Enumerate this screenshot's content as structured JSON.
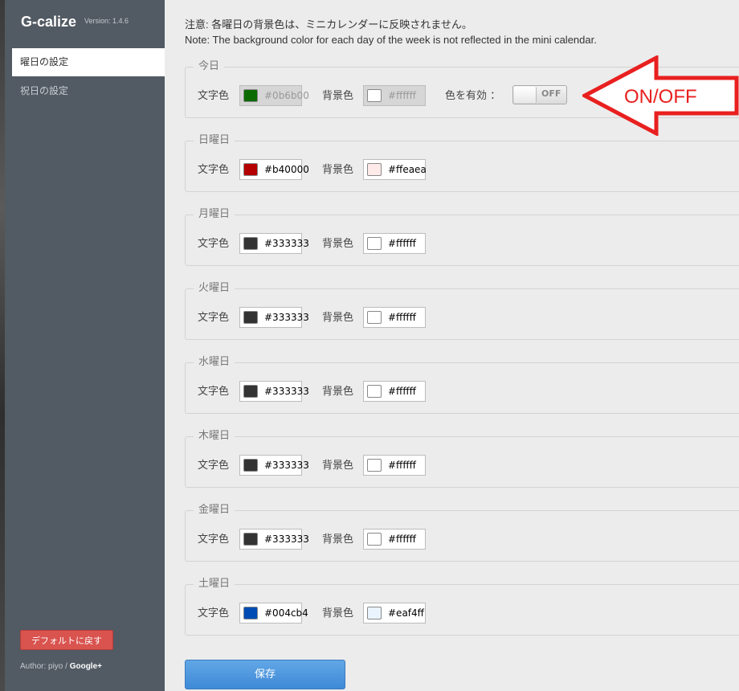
{
  "sidebar": {
    "title": "G-calize",
    "version": "Version: 1.4.6",
    "items": [
      {
        "label": "曜日の設定"
      },
      {
        "label": "祝日の設定"
      }
    ],
    "default_button": "デフォルトに戻す",
    "author_prefix": "Author: piyo / ",
    "author_link": "Google+"
  },
  "notice": {
    "jp": "注意: 各曜日の背景色は、ミニカレンダーに反映されません。",
    "en": "Note: The background color for each day of the week is not reflected in the mini calendar."
  },
  "labels": {
    "text_color": "文字色",
    "bg_color": "背景色",
    "enable": "色を有効 ："
  },
  "sections": [
    {
      "legend": "今日",
      "text_hex": "#0b6b00",
      "bg_hex": "#ffffff",
      "text_color": "#0b6b00",
      "bg_color": "#ffffff",
      "toggle": "OFF"
    },
    {
      "legend": "日曜日",
      "text_hex": "#b40000",
      "bg_hex": "#ffeaea",
      "text_color": "#b40000",
      "bg_color": "#ffeaea"
    },
    {
      "legend": "月曜日",
      "text_hex": "#333333",
      "bg_hex": "#ffffff",
      "text_color": "#333333",
      "bg_color": "#ffffff"
    },
    {
      "legend": "火曜日",
      "text_hex": "#333333",
      "bg_hex": "#ffffff",
      "text_color": "#333333",
      "bg_color": "#ffffff"
    },
    {
      "legend": "水曜日",
      "text_hex": "#333333",
      "bg_hex": "#ffffff",
      "text_color": "#333333",
      "bg_color": "#ffffff"
    },
    {
      "legend": "木曜日",
      "text_hex": "#333333",
      "bg_hex": "#ffffff",
      "text_color": "#333333",
      "bg_color": "#ffffff"
    },
    {
      "legend": "金曜日",
      "text_hex": "#333333",
      "bg_hex": "#ffffff",
      "text_color": "#333333",
      "bg_color": "#ffffff"
    },
    {
      "legend": "土曜日",
      "text_hex": "#004cb4",
      "bg_hex": "#eaf4ff",
      "text_color": "#004cb4",
      "bg_color": "#eaf4ff"
    }
  ],
  "save_button": "保存",
  "annotation": "ON/OFF"
}
